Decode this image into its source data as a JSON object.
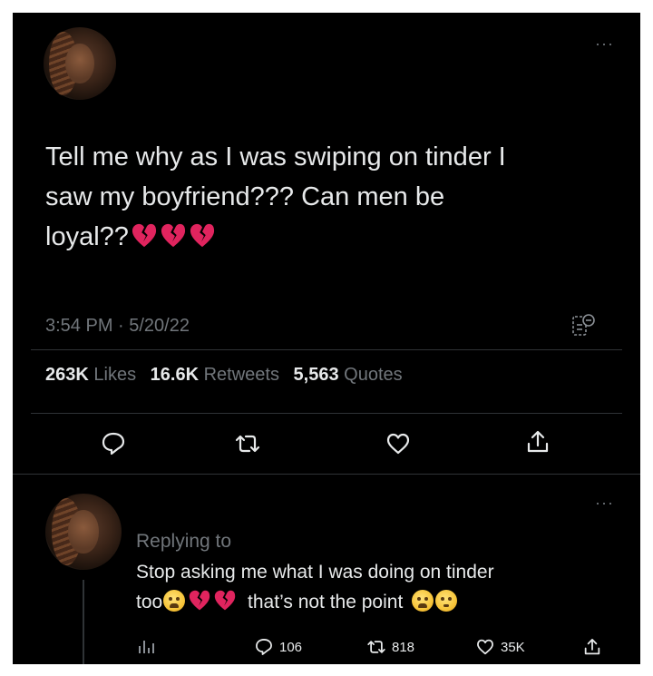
{
  "tweet": {
    "more_label": "···",
    "text_line1": "Tell me why as I was swiping on tinder I",
    "text_line2": "saw my boyfriend??? Can men be",
    "text_line3": "loyal??",
    "text_emojis": [
      "broken-heart",
      "broken-heart",
      "broken-heart"
    ],
    "timestamp": "3:54 PM · 5/20/22",
    "stats": [
      {
        "value": "263K",
        "label": "Likes"
      },
      {
        "value": "16.6K",
        "label": "Retweets"
      },
      {
        "value": "5,563",
        "label": "Quotes"
      }
    ],
    "actions": [
      "reply-icon",
      "retweet-icon",
      "like-icon",
      "share-icon"
    ],
    "colors": {
      "background": "#000000",
      "text": "#e7e9ea",
      "muted": "#71767b",
      "heart": "#e0245e"
    }
  },
  "reply": {
    "more_label": "···",
    "replying_to": "Replying to",
    "line1": "Stop asking me what I was doing on tinder",
    "line2_start": "too",
    "line2_end": "that’s not the point",
    "counts": {
      "replies": "106",
      "retweets": "818",
      "likes": "35K"
    }
  }
}
